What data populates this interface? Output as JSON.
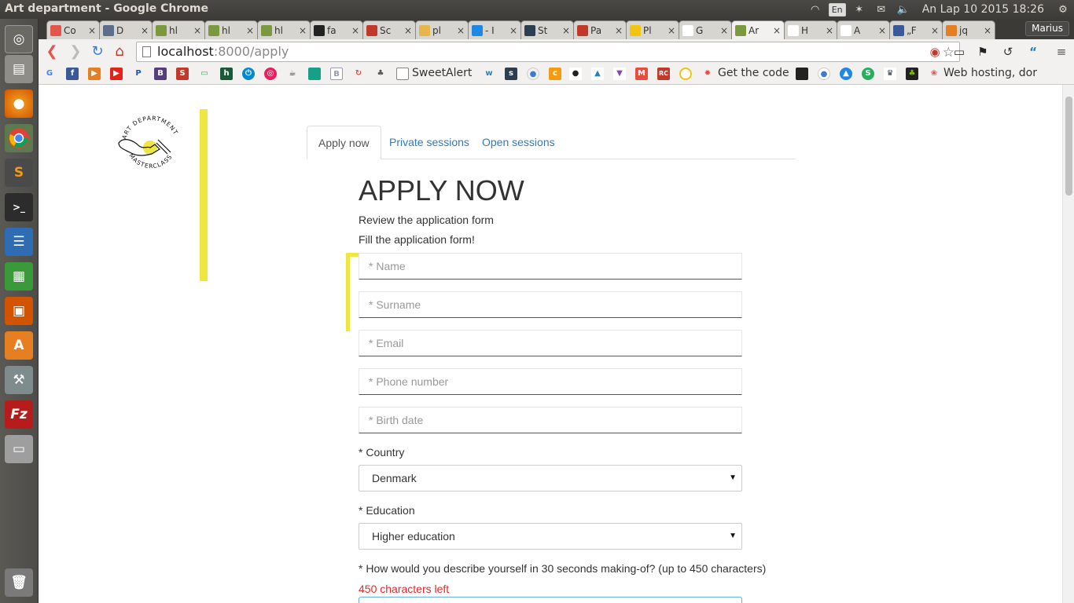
{
  "window": {
    "title": "Art department - Google Chrome"
  },
  "tray": {
    "lang": "En",
    "clock": "An Lap 10 2015 18:26"
  },
  "profile": {
    "name": "Marius"
  },
  "tabs": [
    {
      "title": "Co",
      "color": "#e2574c"
    },
    {
      "title": "D",
      "color": "#5b6e8c"
    },
    {
      "title": "hl",
      "color": "#7a9a3d"
    },
    {
      "title": "hl",
      "color": "#7a9a3d"
    },
    {
      "title": "hl",
      "color": "#7a9a3d"
    },
    {
      "title": "fa",
      "color": "#222222"
    },
    {
      "title": "Sc",
      "color": "#c0392b"
    },
    {
      "title": "pl",
      "color": "#e8b44c"
    },
    {
      "title": "- I",
      "color": "#1e88e5"
    },
    {
      "title": "St",
      "color": "#2c3e50"
    },
    {
      "title": "Pa",
      "color": "#c0392b"
    },
    {
      "title": "Pl",
      "color": "#f1c40f"
    },
    {
      "title": "G",
      "color": "#ffffff"
    },
    {
      "title": "Ar",
      "color": "#7a9a3d"
    },
    {
      "title": "H",
      "color": "#ffffff"
    },
    {
      "title": "A",
      "color": "#ffffff"
    },
    {
      "title": "„F",
      "color": "#3b5998"
    },
    {
      "title": "jq",
      "color": "#e67e22"
    }
  ],
  "address": {
    "host": "localhost",
    "path": ":8000/apply"
  },
  "bookmarks": {
    "sweetalert": "SweetAlert",
    "get_the_code": "Get the code",
    "web_hosting": "Web hosting, dor"
  },
  "nav_tabs": [
    "Apply now",
    "Private sessions",
    "Open sessions"
  ],
  "heading": "APPLY NOW",
  "review_text": "Review the application form",
  "fill_text": "Fill the application form!",
  "fields": {
    "name": "* Name",
    "surname": "* Surname",
    "email": "* Email",
    "phone": "* Phone number",
    "birth": "* Birth date"
  },
  "country": {
    "label": "* Country",
    "value": "Denmark"
  },
  "education": {
    "label": "* Education",
    "value": "Higher education"
  },
  "describe_label": "* How would you describe yourself in 30 seconds making-of? (up to 450 characters)",
  "chars_left": "450 characters left",
  "logo": {
    "text_top": "ART DEPARTMENT",
    "text_bottom": "MASTERCLASS"
  },
  "colors": {
    "accent_yellow": "#f0e642",
    "link_blue": "#337ab7",
    "counter_red": "#e02b2b"
  }
}
